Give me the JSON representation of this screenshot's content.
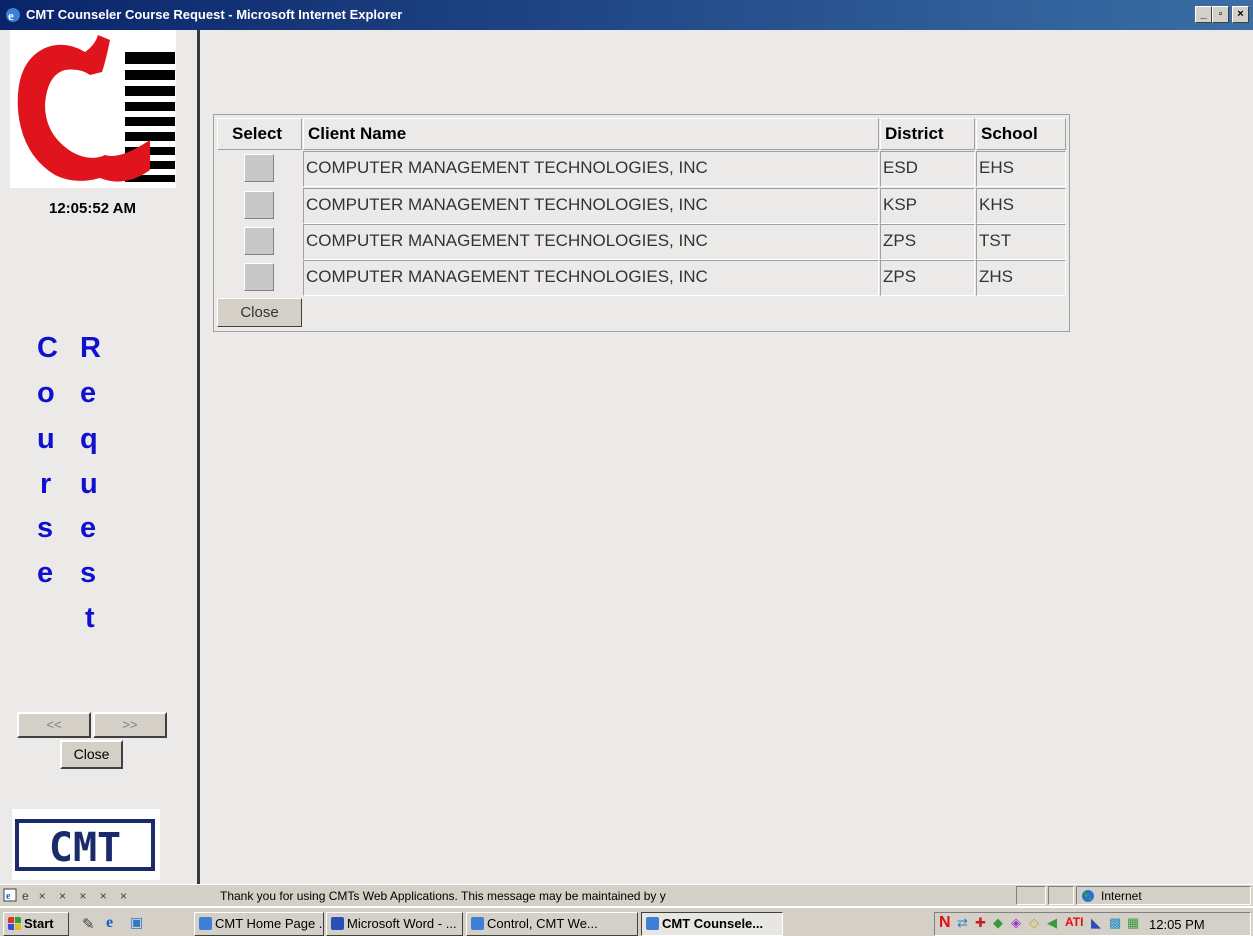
{
  "window": {
    "title": "CMT Counseler Course Request - Microsoft Internet Explorer",
    "minimize": "_",
    "maximize": "▫",
    "close": "×"
  },
  "sidebar": {
    "clock": "12:05:52 AM",
    "word1": [
      "C",
      "o",
      "u",
      "r",
      "s",
      "e"
    ],
    "word2": [
      "R",
      "e",
      "q",
      "u",
      "e",
      "s",
      "t"
    ],
    "prev_label": "<<",
    "next_label": ">>",
    "close_label": "Close",
    "logo_text": "CMT"
  },
  "grid": {
    "headers": {
      "select": "Select",
      "client": "Client Name",
      "district": "District",
      "school": "School"
    },
    "rows": [
      {
        "client": "COMPUTER MANAGEMENT TECHNOLOGIES, INC",
        "district": "ESD",
        "school": "EHS"
      },
      {
        "client": "COMPUTER MANAGEMENT TECHNOLOGIES, INC",
        "district": "KSP",
        "school": "KHS"
      },
      {
        "client": "COMPUTER MANAGEMENT TECHNOLOGIES, INC",
        "district": "ZPS",
        "school": "TST"
      },
      {
        "client": "COMPUTER MANAGEMENT TECHNOLOGIES, INC",
        "district": "ZPS",
        "school": "ZHS"
      }
    ],
    "close_label": "Close"
  },
  "statusbar": {
    "progress_text": "e   ×    ×    ×    ×    ×",
    "message": "Thank you for using CMTs Web Applications.  This message may be maintained by y",
    "zone": "Internet"
  },
  "taskbar": {
    "start": "Start",
    "tasks": [
      "CMT Home Page ...",
      "Microsoft Word - ...",
      "Control, CMT We...",
      "CMT Counsele..."
    ],
    "time": "12:05 PM"
  },
  "colors": {
    "apple_red": "#e0141c",
    "sidebar_letters": "#1010d0",
    "cmt_logo": "#1a2a6a"
  }
}
